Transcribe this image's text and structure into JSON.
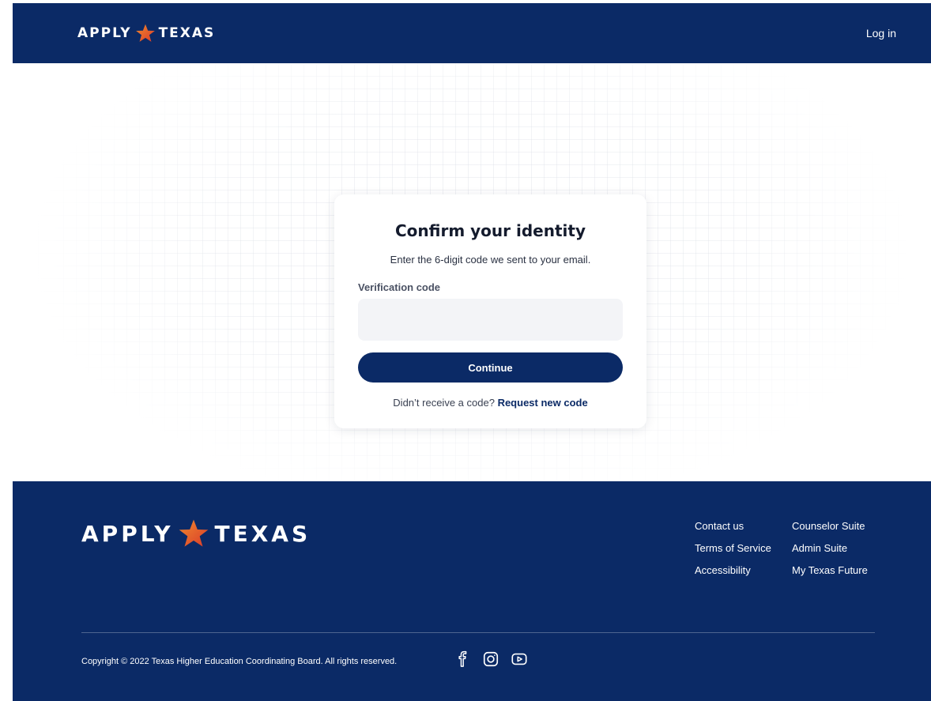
{
  "header": {
    "logo_left": "APPLY",
    "logo_right": "TEXAS",
    "login_label": "Log in"
  },
  "card": {
    "title": "Confirm your identity",
    "subtitle": "Enter the 6-digit code we sent to your email.",
    "field_label": "Verification code",
    "field_value": "",
    "field_placeholder": "",
    "continue_label": "Continue",
    "resend_prompt": "Didn’t receive a code?",
    "resend_link": "Request new code"
  },
  "footer": {
    "logo_left": "APPLY",
    "logo_right": "TEXAS",
    "links_col1": [
      "Contact us",
      "Terms of Service",
      "Accessibility"
    ],
    "links_col2": [
      "Counselor Suite",
      "Admin Suite",
      "My Texas Future"
    ],
    "copyright": "Copyright © 2022 Texas Higher Education Coordinating Board. All rights reserved.",
    "social": [
      "facebook-icon",
      "instagram-icon",
      "youtube-icon"
    ]
  },
  "colors": {
    "brand_navy": "#0b2a66",
    "star_red": "#d93a2b",
    "star_orange": "#f08a2c",
    "input_bg": "#f3f4f7"
  }
}
